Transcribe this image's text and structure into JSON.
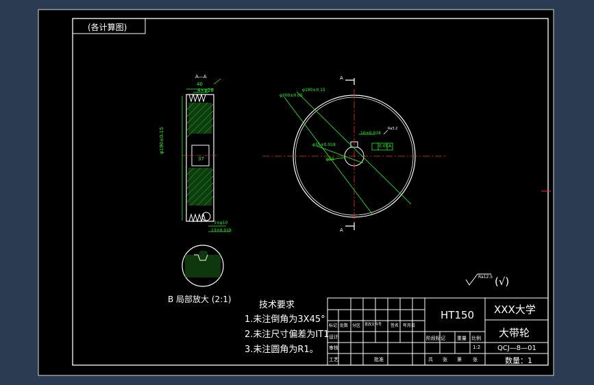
{
  "colors": {
    "outer_bg": "#2b3c52",
    "paper": "#000000",
    "line": "#ffffff",
    "dimension": "#1dff1d",
    "centerline": "#ff2a2a",
    "hatch": "#1dff1d"
  },
  "drawing": {
    "stamp_label": "(各计算图)",
    "section_label": "A—A",
    "section_dims": {
      "width_total": "40",
      "groove": "4×φ28",
      "od": "φ190±0.15",
      "bore_depth": "37",
      "keyway": "φ35",
      "lower_tol": "3×φ10",
      "lower_dim": "13±0.018"
    },
    "front_view": {
      "dim_outer": "φ190±0.15",
      "dim_pitch": "φ200±0.05",
      "dim_bore": "φ35±0.018",
      "dim_hub": "φ50",
      "tol_value": "0.05",
      "datum": "A",
      "keyway_dim": "10±0.018",
      "roughness_small": "Ra3.2",
      "section_a_top": "A",
      "section_a_bottom": "A"
    },
    "detail_label": "B 局部放大  (2:1)",
    "roughness_general": "Ra12.5",
    "roughness_general_suffix": "(√)"
  },
  "tech_requirements": {
    "title": "技术要求",
    "items": [
      "1.未注倒角为3X45°",
      "2.未注尺寸偏差为IT1",
      "3.未注圆角为R1。"
    ]
  },
  "title_block": {
    "material": "HT150",
    "school": "XXX大学",
    "part_name": "大带轮",
    "drawing_no": "QCJ—8—01",
    "qty_label": "数量：1",
    "scale_value": "1:2",
    "row_headers": [
      "标记",
      "处数",
      "分区",
      "更改文件号",
      "签名",
      "年月日"
    ],
    "side_labels": [
      "设计",
      "审核",
      "工艺"
    ],
    "stage_labels": [
      "阶段标记",
      "重量",
      "比例"
    ],
    "bottom_labels": [
      "共",
      "张",
      "第",
      "张"
    ],
    "approve": "批准"
  }
}
